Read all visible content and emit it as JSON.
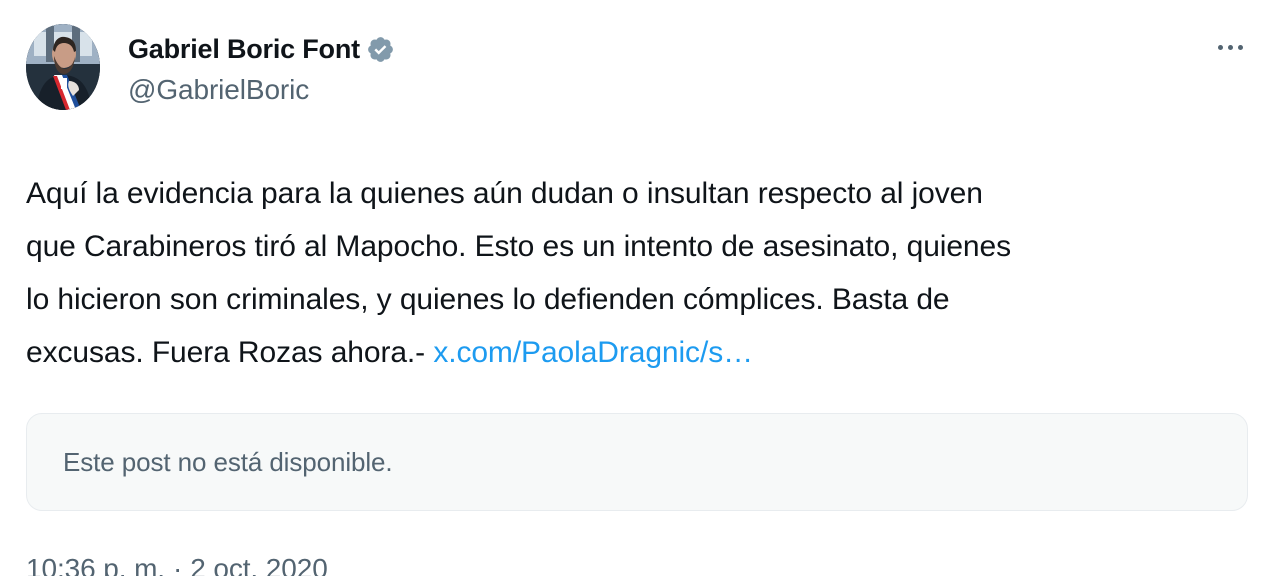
{
  "author": {
    "display_name": "Gabriel Boric Font",
    "handle": "@GabrielBoric",
    "verified_icon": "verified-badge-icon"
  },
  "tweet": {
    "text_parts": {
      "line1": "Aquí la evidencia para la quienes aún dudan o insultan respecto al joven",
      "line2": "que Carabineros tiró al Mapocho. Esto es un intento de asesinato, quienes",
      "line3": "lo hicieron son criminales, y quienes lo defienden cómplices. Basta de",
      "line4_prefix": "excusas. Fuera Rozas ahora.-"
    },
    "link_text": "x.com/PaolaDragnic/s…"
  },
  "quoted_post": {
    "unavailable_text": "Este post no está disponible."
  },
  "timestamp": {
    "time": "10:36 p. m.",
    "separator": "·",
    "date": "2 oct. 2020"
  },
  "colors": {
    "link": "#1d9bf0",
    "secondary_text": "#536471",
    "badge": "#829aab"
  }
}
